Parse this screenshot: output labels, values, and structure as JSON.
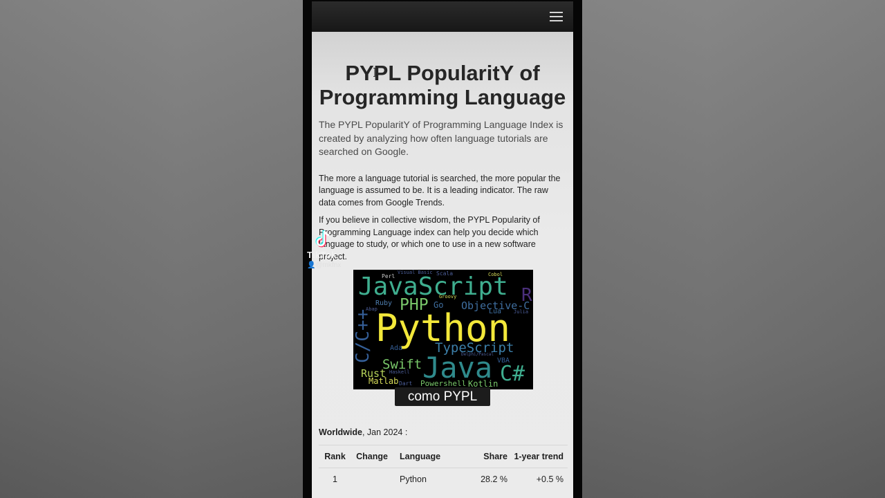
{
  "page": {
    "title": "PYPL PopularitY of Programming Language",
    "lead": "The PYPL PopularitY of Programming Language Index is created by analyzing how often language tutorials are searched on Google.",
    "paragraph1": "The more a language tutorial is searched, the more popular the language is assumed to be. It is a leading indicator. The raw data comes from Google Trends.",
    "paragraph2": "If you believe in collective wisdom, the PYPL Popularity of Programming Language index can help you decide which language to study, or which one to use in a new software project."
  },
  "wordcloud": {
    "words": [
      "JavaScript",
      "Python",
      "Java",
      "PHP",
      "Objective-C",
      "TypeScript",
      "C/C++",
      "C#",
      "R",
      "Swift",
      "Rust",
      "Matlab",
      "Kotlin",
      "Powershell",
      "Ruby",
      "Go",
      "Lua",
      "Perl",
      "Ada",
      "VBA",
      "Groovy",
      "Cobol",
      "Scala",
      "Haskell",
      "Abap",
      "Julia",
      "Delphi/Pascal",
      "Dart",
      "Visual Basic"
    ],
    "colors": {
      "bg": "#000000",
      "yellow": "#f3e83a",
      "teal": "#3fae8f",
      "green": "#79c86a",
      "blue": "#4d6fa5",
      "purple": "#5a3f86"
    }
  },
  "caption": "como PYPL",
  "ranking": {
    "scope_bold": "Worldwide",
    "scope_rest": ", Jan 2024 :",
    "headers": [
      "Rank",
      "Change",
      "Language",
      "Share",
      "1-year trend"
    ],
    "rows": [
      {
        "rank": "1",
        "change": "",
        "language": "Python",
        "share": "28.2 %",
        "trend": "+0.5 %"
      }
    ]
  },
  "overlay": {
    "brand": "TikTok",
    "user": "@mkfnx"
  },
  "icons": {
    "menu": "hamburger-icon",
    "tiktok": "tiktok-logo-icon",
    "user": "user-icon",
    "cursor": "text-cursor-icon"
  }
}
